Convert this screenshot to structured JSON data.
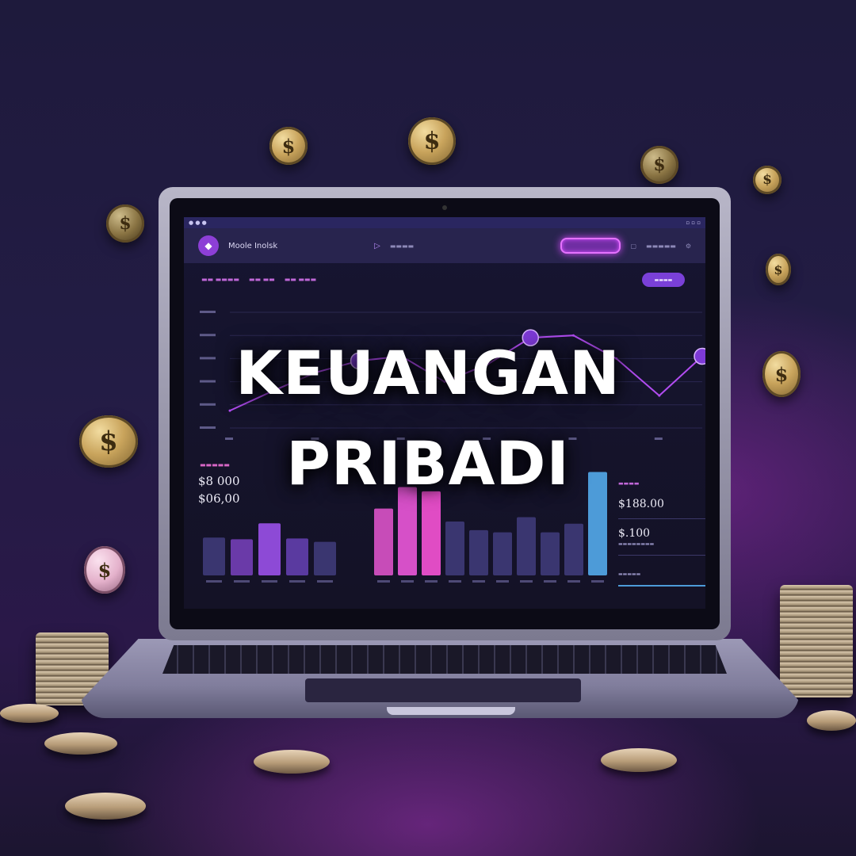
{
  "headline": {
    "line1": "KEUANGAN",
    "line2": "PRIBADI"
  },
  "dashboard": {
    "brand": "Moole Inolsk",
    "panel_left_values": [
      "$8 000",
      "$06,00"
    ],
    "panel_right_values": [
      "$188.00",
      "$.100"
    ],
    "coin_symbol": "$"
  },
  "chart_data": {
    "type": "line",
    "x": [
      1,
      2,
      3,
      4,
      5,
      6,
      7,
      8,
      9,
      10,
      11,
      12
    ],
    "series": [
      {
        "values": [
          15,
          32,
          48,
          58,
          62,
          40,
          55,
          78,
          80,
          60,
          28,
          62
        ]
      }
    ],
    "ylim": [
      0,
      100
    ],
    "grid": true
  },
  "bar_data": {
    "type": "bar",
    "groups": [
      {
        "values": [
          45,
          43,
          62,
          44,
          40
        ]
      },
      {
        "values": [
          62,
          82,
          78,
          50,
          42,
          40,
          54,
          40,
          48,
          96
        ]
      }
    ]
  },
  "colors": {
    "accent": "#9b4dff",
    "magenta": "#e04cc4",
    "cyan": "#4d9bd8",
    "background": "#1e1a3c"
  }
}
